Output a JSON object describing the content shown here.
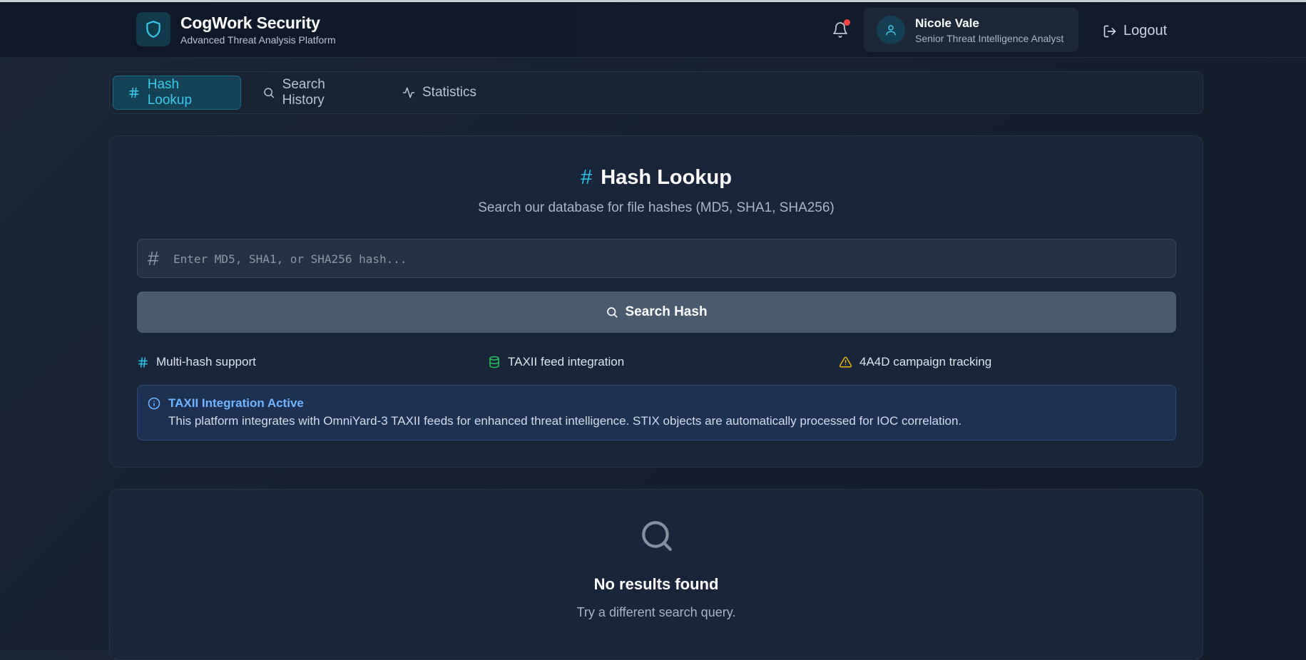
{
  "header": {
    "brand_title": "CogWork Security",
    "brand_subtitle": "Advanced Threat Analysis Platform",
    "notification_count_dot": true,
    "user_name": "Nicole Vale",
    "user_role": "Senior Threat Intelligence Analyst",
    "logout_label": "Logout"
  },
  "tabs": [
    {
      "label": "Hash Lookup",
      "icon": "hash-icon",
      "active": true
    },
    {
      "label": "Search History",
      "icon": "search-icon",
      "active": false
    },
    {
      "label": "Statistics",
      "icon": "activity-icon",
      "active": false
    }
  ],
  "lookup": {
    "title": "Hash Lookup",
    "subtitle": "Search our database for file hashes (MD5, SHA1, SHA256)",
    "input_value": "",
    "input_placeholder": "Enter MD5, SHA1, or SHA256 hash...",
    "search_button_label": "Search Hash",
    "features": [
      {
        "label": "Multi-hash support",
        "icon": "hash-icon",
        "color": "#29c3ea"
      },
      {
        "label": "TAXII feed integration",
        "icon": "database-icon",
        "color": "#22c55e"
      },
      {
        "label": "4A4D campaign tracking",
        "icon": "warning-icon",
        "color": "#eab308"
      }
    ],
    "info": {
      "title": "TAXII Integration Active",
      "text": "This platform integrates with OmniYard-3 TAXII feeds for enhanced threat intelligence. STIX objects are automatically processed for IOC correlation."
    }
  },
  "results": {
    "empty_title": "No results found",
    "empty_subtitle": "Try a different search query."
  },
  "colors": {
    "accent": "#29c3ea",
    "background": "#16202f",
    "info": "#6fb6ff",
    "alert_dot": "#ef4444"
  }
}
